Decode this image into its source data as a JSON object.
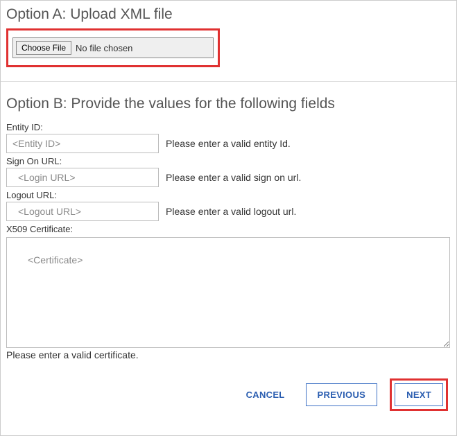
{
  "optionA": {
    "title": "Option A: Upload XML file",
    "choose_label": "Choose File",
    "file_status": "No file chosen"
  },
  "optionB": {
    "title": "Option B: Provide the values for the following fields",
    "entity_id": {
      "label": "Entity ID:",
      "placeholder": "<Entity ID>",
      "hint": "Please enter a valid entity Id."
    },
    "sign_on": {
      "label": "Sign On URL:",
      "placeholder": "<Login URL>",
      "hint": "Please enter a valid sign on url."
    },
    "logout": {
      "label": "Logout URL:",
      "placeholder": "<Logout URL>",
      "hint": "Please enter a valid logout url."
    },
    "certificate": {
      "label": "X509 Certificate:",
      "placeholder": "<Certificate>",
      "hint": "Please enter a valid certificate."
    }
  },
  "footer": {
    "cancel": "CANCEL",
    "previous": "PREVIOUS",
    "next": "NEXT"
  }
}
